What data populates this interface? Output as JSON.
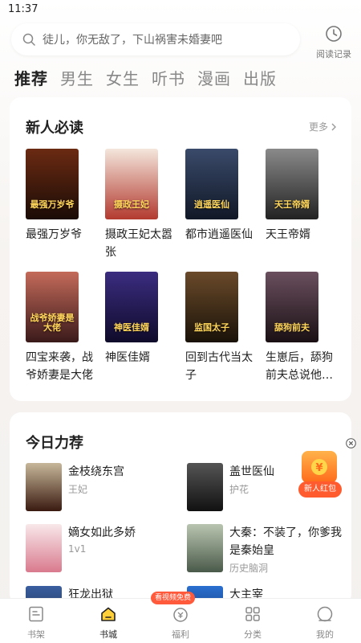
{
  "status_bar": {
    "time": "11:37"
  },
  "search": {
    "placeholder": "徒儿，你无敌了，下山祸害未婚妻吧"
  },
  "history": {
    "label": "阅读记录"
  },
  "tabs": [
    {
      "label": "推荐",
      "active": true
    },
    {
      "label": "男生"
    },
    {
      "label": "女生"
    },
    {
      "label": "听书"
    },
    {
      "label": "漫画"
    },
    {
      "label": "出版"
    }
  ],
  "section_new": {
    "title": "新人必读",
    "more": "更多",
    "books": [
      {
        "title": "最强万岁爷",
        "cover_text": "最强万岁爷",
        "cover_colors": [
          "#6b2a12",
          "#1a0c06"
        ]
      },
      {
        "title": "摄政王妃太嚣张",
        "cover_text": "摄政王妃",
        "cover_colors": [
          "#f4e6dc",
          "#b33a2f"
        ]
      },
      {
        "title": "都市逍遥医仙",
        "cover_text": "逍遥医仙",
        "cover_colors": [
          "#3a4a6a",
          "#111827"
        ]
      },
      {
        "title": "天王帝婿",
        "cover_text": "天王帝婿",
        "cover_colors": [
          "#8a8a8a",
          "#222222"
        ]
      },
      {
        "title": "四宝来袭，战爷娇妻是大佬",
        "cover_text": "战爷娇妻是大佬",
        "cover_colors": [
          "#c46a5a",
          "#3a1a1a"
        ]
      },
      {
        "title": "神医佳婿",
        "cover_text": "神医佳婿",
        "cover_colors": [
          "#3b2c80",
          "#0f0b2a"
        ]
      },
      {
        "title": "回到古代当太子",
        "cover_text": "监国太子",
        "cover_colors": [
          "#6a4a2a",
          "#1a1208"
        ]
      },
      {
        "title": "生崽后，舔狗前夫总说他…",
        "cover_text": "舔狗前夫",
        "cover_colors": [
          "#6a4f5e",
          "#1a1014"
        ]
      }
    ]
  },
  "section_today": {
    "title": "今日力荐",
    "books": [
      {
        "title": "金枝绕东宫",
        "sub": "王妃",
        "cover_colors": [
          "#c7b79a",
          "#3a1a10"
        ]
      },
      {
        "title": "盖世医仙",
        "sub": "护花",
        "cover_colors": [
          "#555555",
          "#111111"
        ]
      },
      {
        "title": "嫡女如此多娇",
        "sub": "1v1",
        "cover_colors": [
          "#f8e8ea",
          "#d97a8e"
        ]
      },
      {
        "title": "大秦：不装了，你爹我是秦始皇",
        "sub": "历史脑洞",
        "cover_colors": [
          "#b9c5b0",
          "#4a5a4a"
        ]
      },
      {
        "title": "狂龙出狱",
        "sub": "",
        "cover_colors": [
          "#3a5fa0",
          "#11203a"
        ]
      },
      {
        "title": "大主宰",
        "sub": "",
        "cover_colors": [
          "#2a6fd0",
          "#0e2a5a"
        ]
      }
    ]
  },
  "redpack": {
    "label": "新人红包"
  },
  "bottom_nav": [
    {
      "label": "书架"
    },
    {
      "label": "书城",
      "active": true
    },
    {
      "label": "福利",
      "badge": "看视频免费"
    },
    {
      "label": "分类"
    },
    {
      "label": "我的"
    }
  ],
  "colors": {
    "accent": "#ff5a3c",
    "text": "#222222",
    "muted": "#999999"
  }
}
